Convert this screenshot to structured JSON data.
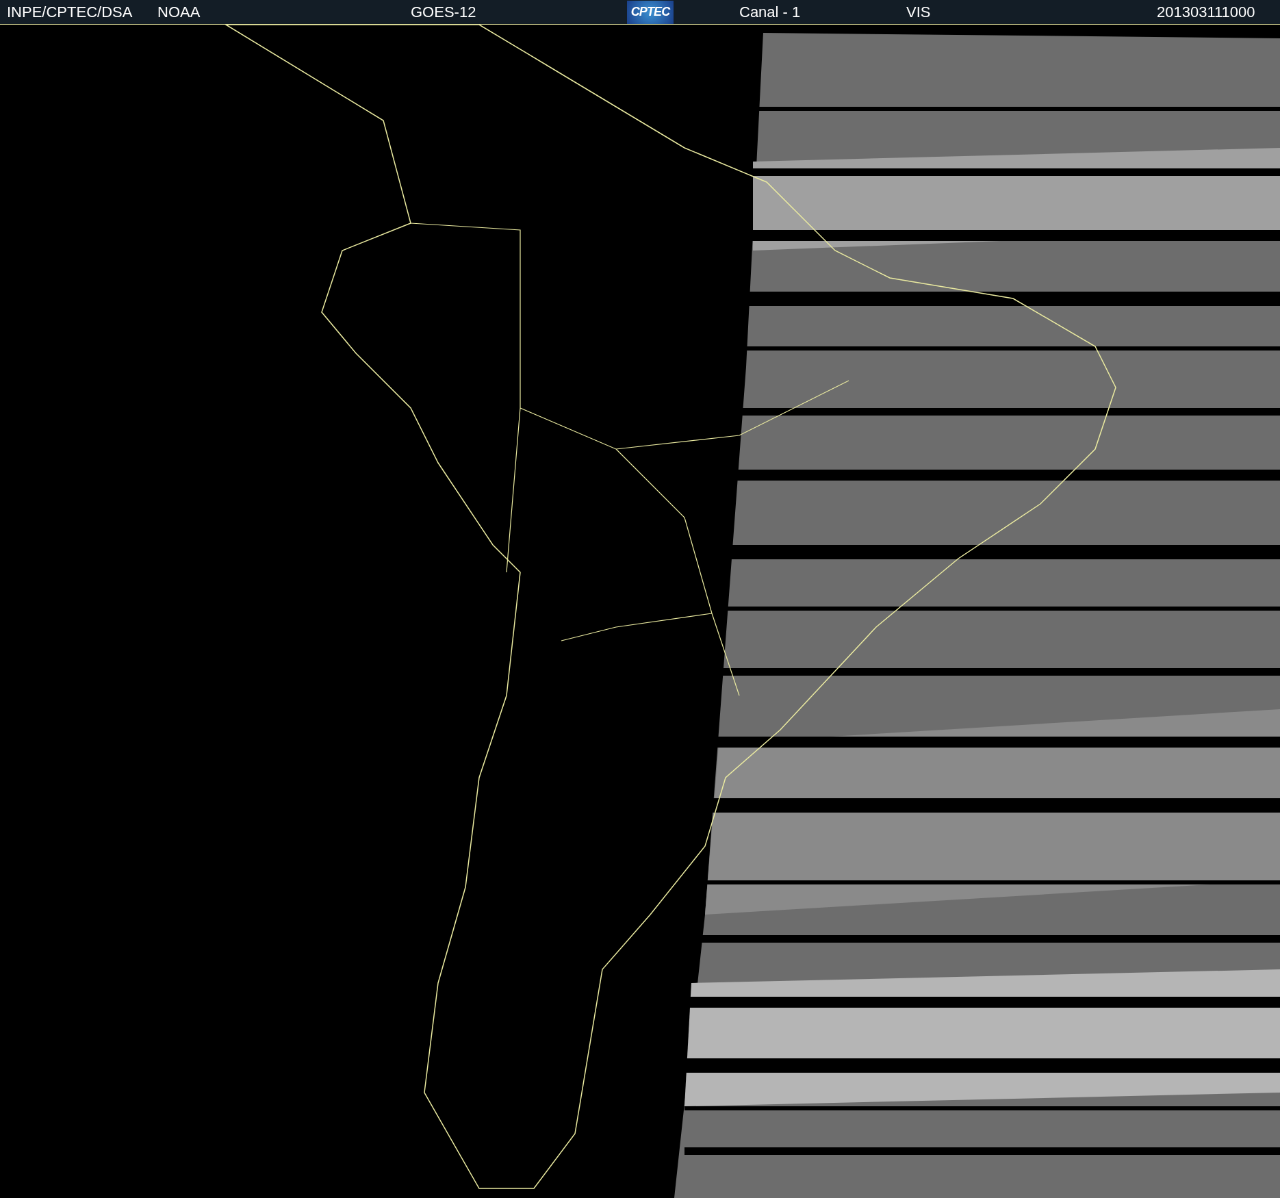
{
  "header": {
    "source": "INPE/CPTEC/DSA",
    "agency": "NOAA",
    "satellite": "GOES-12",
    "logo": "CPTEC",
    "channel": "Canal - 1",
    "band": "VIS",
    "timestamp": "201303111000"
  }
}
